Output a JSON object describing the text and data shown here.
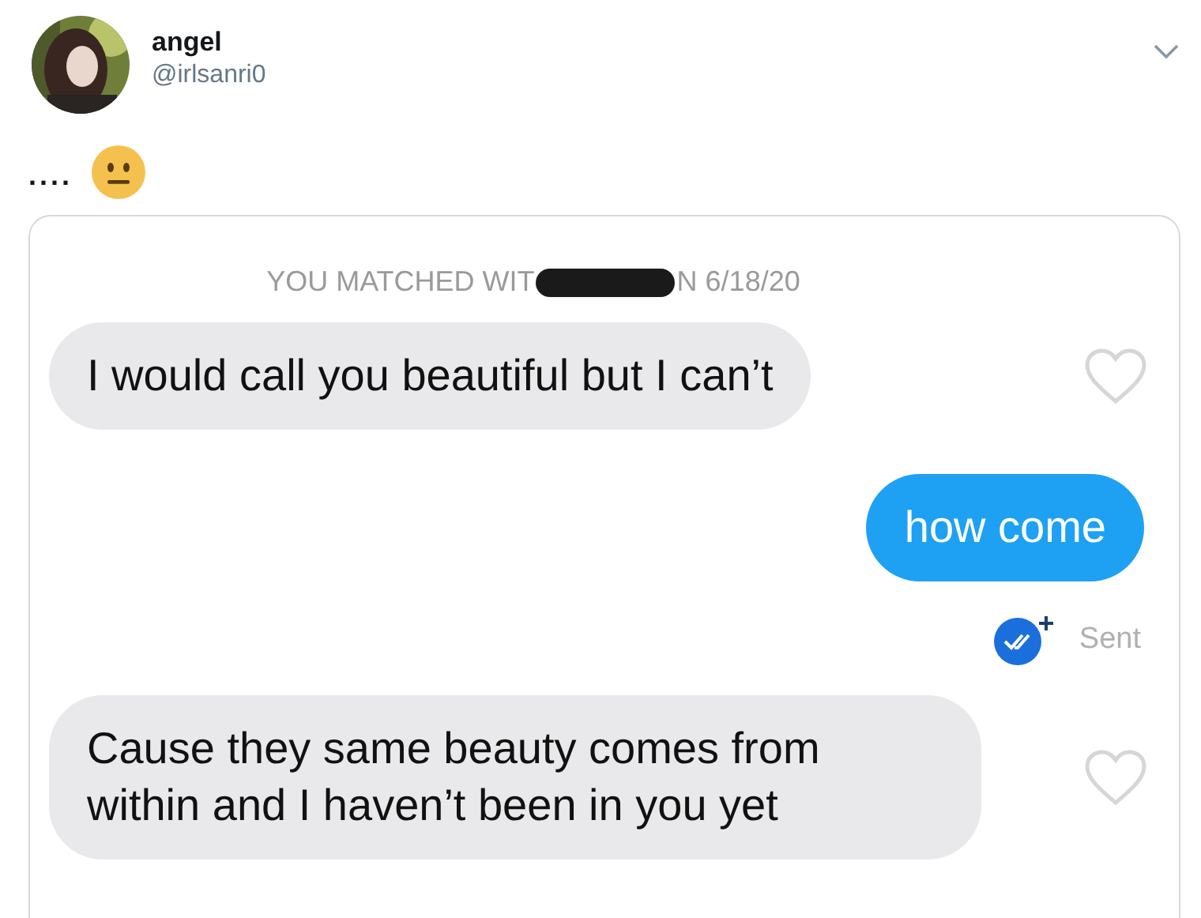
{
  "tweet": {
    "name": "angel",
    "handle": "@irlsanri0",
    "text": "...."
  },
  "chat": {
    "match_banner": {
      "before": "YOU MATCHED WIT",
      "after": "N 6/18/20",
      "redacted": true
    },
    "messages": [
      {
        "kind": "received",
        "text": "I would call you beautiful but I can’t",
        "liked": false
      },
      {
        "kind": "sent",
        "text": "how come",
        "status": "Sent"
      },
      {
        "kind": "received",
        "text": "Cause they same beauty comes from within and I haven’t been in you yet",
        "liked": false
      }
    ]
  }
}
